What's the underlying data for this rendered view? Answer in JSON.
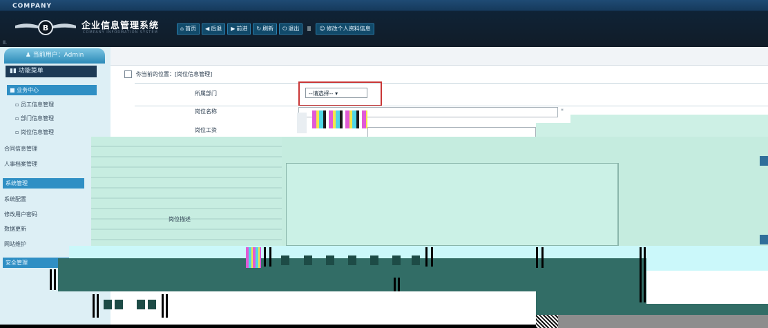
{
  "header": {
    "company": "COMPANY",
    "title": "企业信息管理系统",
    "subtitle": "COMPANY INFORMATION SYSTEM",
    "nav": [
      {
        "icon": "home-icon",
        "label": "首页"
      },
      {
        "icon": "back-arrow-icon",
        "label": "后退"
      },
      {
        "icon": "forward-arrow-icon",
        "label": "前进"
      },
      {
        "icon": "refresh-icon",
        "label": "刷新"
      },
      {
        "icon": "exit-icon",
        "label": "退出"
      },
      {
        "icon": "personal-icon",
        "label": "修改个人资料信息"
      }
    ],
    "corner_mark": "ll."
  },
  "sidebar": {
    "user": "当前用户：Admin",
    "menu_title": "功能菜单",
    "sections": {
      "task": "业务中心",
      "system": "系统管理",
      "security": "安全管理"
    },
    "items": {
      "employee": "员工信息管理",
      "department": "部门信息管理",
      "position": "岗位信息管理",
      "contract": "合同信息管理",
      "personnel": "人事档案管理",
      "sys_config": "系统配置",
      "user_password": "修改用户密码",
      "data_update": "数据更新",
      "site_maintain": "网站维护"
    }
  },
  "main": {
    "location_label": "你当前的位置：[岗位信息管理]",
    "fields": {
      "department_label": "所属部门",
      "department_value": "--请选择--",
      "position_name_label": "岗位名称",
      "position_salary_label": "岗位工资",
      "position_desc_label": "岗位描述",
      "required_mark": "*"
    }
  },
  "colors": {
    "header_dark": "#111c28",
    "accent_blue": "#2f8fc4",
    "highlight_red": "#c93535",
    "glitch_light": "#c5ecdf",
    "glitch_dark": "#326d66"
  }
}
